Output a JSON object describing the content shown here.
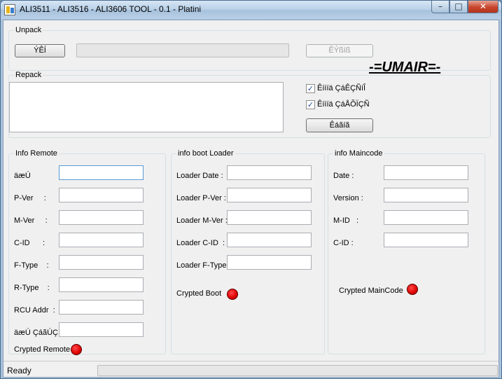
{
  "window": {
    "title": "ALI3511 - ALI3516 - ALI3606  TOOL - 0.1  - Platini",
    "minimize_glyph": "–",
    "maximize_glyph": "□",
    "close_glyph": "✕"
  },
  "unpack": {
    "legend": "Unpack",
    "button_label": "ÝÊÍ",
    "button2_label": "ÊÝßíß",
    "progress": 0
  },
  "brand": "-=UMAIR=-",
  "repack": {
    "legend": "Repack",
    "memo_value": "",
    "check1_label": "Êíííä ÇáÊÇÑíÎ",
    "check1_checked": true,
    "check2_label": "Êíííä ÇáÅÕÏÇÑ",
    "check2_checked": true,
    "button_label": "Êáãíã",
    "check_glyph": "✓"
  },
  "info_remote": {
    "legend": "Info Remote",
    "fields": [
      {
        "label": "äæÚ",
        "value": ""
      },
      {
        "label": "P-Ver     :",
        "value": ""
      },
      {
        "label": "M-Ver     :",
        "value": ""
      },
      {
        "label": "C-ID      :",
        "value": ""
      },
      {
        "label": "F-Type    :",
        "value": ""
      },
      {
        "label": "R-Type    :",
        "value": ""
      },
      {
        "label": "RCU Addr  :",
        "value": ""
      },
      {
        "label": "äæÚ ÇáãÚÇ",
        "value": ""
      }
    ],
    "crypted_label": "Crypted Remote",
    "crypted_color": "#dd0000"
  },
  "info_boot": {
    "legend": "info boot Loader",
    "fields": [
      {
        "label": "Loader Date :",
        "value": ""
      },
      {
        "label": "Loader P-Ver :",
        "value": ""
      },
      {
        "label": "Loader M-Ver :",
        "value": ""
      },
      {
        "label": "Loader C-ID  :",
        "value": ""
      },
      {
        "label": "Loader F-Type:",
        "value": ""
      }
    ],
    "crypted_label": "Crypted Boot",
    "crypted_color": "#dd0000"
  },
  "info_main": {
    "legend": "info Maincode",
    "fields": [
      {
        "label": "Date :",
        "value": ""
      },
      {
        "label": "Version :",
        "value": ""
      },
      {
        "label": "M-ID   :",
        "value": ""
      },
      {
        "label": "C-ID :",
        "value": ""
      }
    ],
    "crypted_label": "Crypted MainCode",
    "crypted_color": "#dd0000"
  },
  "status": {
    "text": "Ready"
  }
}
